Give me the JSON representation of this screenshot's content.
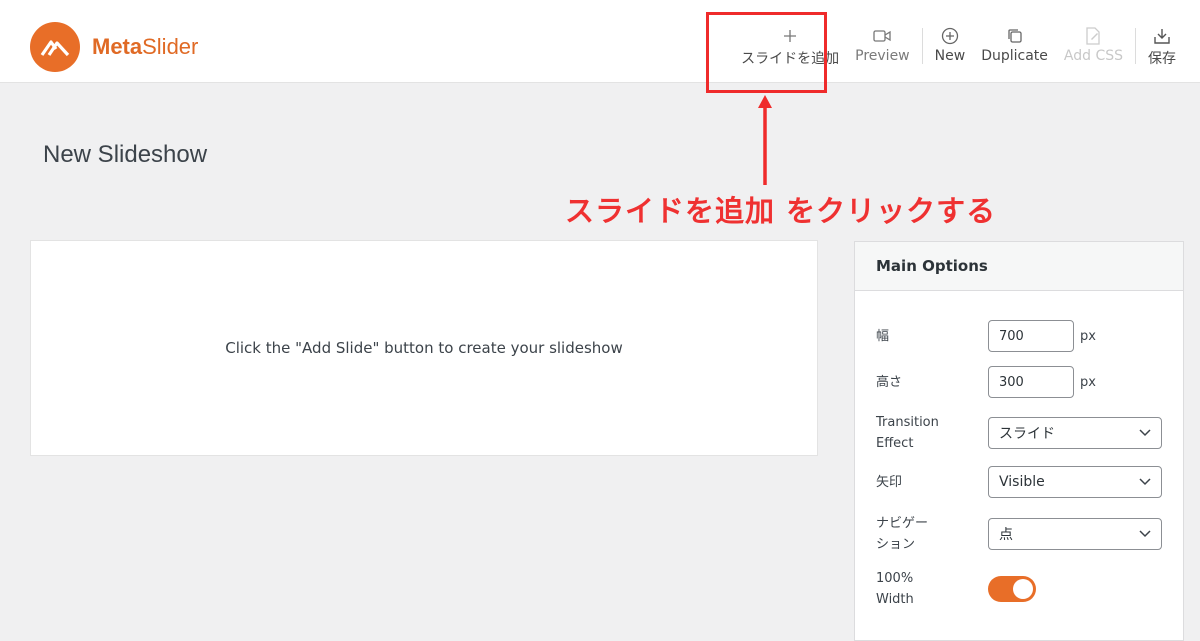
{
  "app": {
    "logo_bold": "Meta",
    "logo_light": "Slider",
    "brand_color": "#e86e28"
  },
  "toolbar": {
    "items": [
      {
        "label": "スライドを追加",
        "icon": "plus-icon"
      },
      {
        "label": "Preview",
        "icon": "video-camera-icon"
      },
      {
        "label": "New",
        "icon": "circle-plus-icon"
      },
      {
        "label": "Duplicate",
        "icon": "copy-icon"
      },
      {
        "label": "Add CSS",
        "icon": "css-file-icon",
        "disabled": true
      },
      {
        "label": "保存",
        "icon": "save-download-icon"
      }
    ]
  },
  "annotation": {
    "instruction": "スライドを追加 をクリックする",
    "color": "#ef2b2b"
  },
  "page": {
    "title": "New Slideshow",
    "empty_message": "Click the \"Add Slide\" button to create your slideshow"
  },
  "options": {
    "heading": "Main Options",
    "width": {
      "label": "幅",
      "value": "700",
      "unit": "px"
    },
    "height": {
      "label": "高さ",
      "value": "300",
      "unit": "px"
    },
    "transition": {
      "label_line1": "Transition",
      "label_line2": "Effect",
      "value": "スライド"
    },
    "arrows": {
      "label": "矢印",
      "value": "Visible"
    },
    "navigation": {
      "label_line1": "ナビゲー",
      "label_line2": "ション",
      "value": "点"
    },
    "full_width": {
      "label_line1": "100%",
      "label_line2": "Width",
      "enabled": true
    }
  }
}
